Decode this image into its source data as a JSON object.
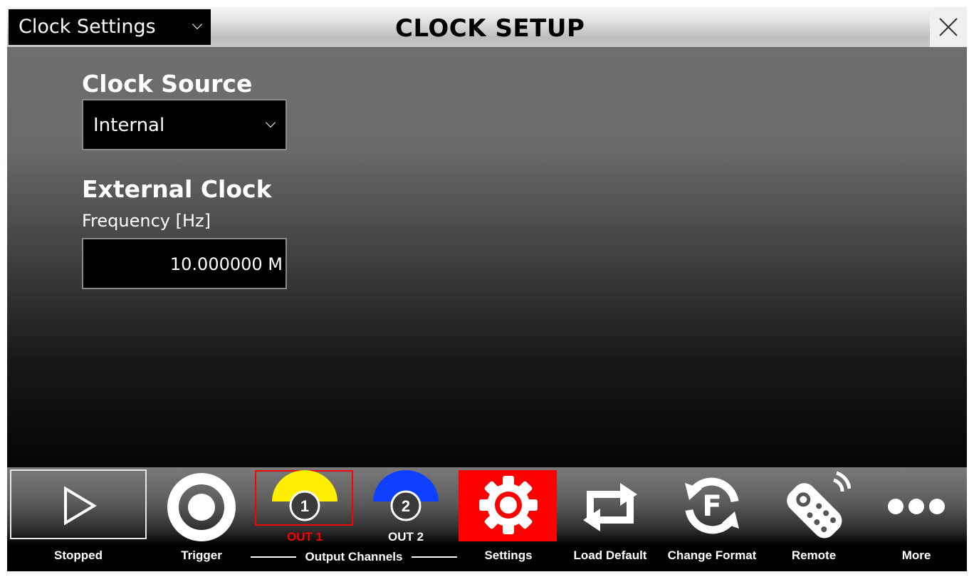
{
  "header": {
    "view_select_value": "Clock Settings",
    "title": "CLOCK SETUP",
    "close_icon": "close-x-icon"
  },
  "clock_source": {
    "title": "Clock Source",
    "value": "Internal"
  },
  "external_clock": {
    "title": "External Clock",
    "frequency_label": "Frequency [Hz]",
    "frequency_value": "10.000000 M"
  },
  "toolbar": {
    "stopped": {
      "label": "Stopped",
      "icon": "play-icon"
    },
    "trigger": {
      "label": "Trigger",
      "icon": "trigger-circle-icon"
    },
    "channels": {
      "group_label": "Output Channels",
      "out1": {
        "number": "1",
        "label": "OUT 1",
        "color": "#ffee00",
        "label_color": "#ff0000",
        "selected": true
      },
      "out2": {
        "number": "2",
        "label": "OUT 2",
        "color": "#1040ff",
        "label_color": "#ffffff",
        "selected": false
      }
    },
    "settings": {
      "label": "Settings",
      "icon": "gear-icon",
      "active_color": "#ff0000"
    },
    "load_default": {
      "label": "Load Default",
      "icon": "repeat-arrows-icon"
    },
    "change_format": {
      "label": "Change Format",
      "icon": "format-f-refresh-icon"
    },
    "remote": {
      "label": "Remote",
      "icon": "remote-control-icon"
    },
    "more": {
      "label": "More",
      "icon": "more-dots-icon"
    }
  }
}
